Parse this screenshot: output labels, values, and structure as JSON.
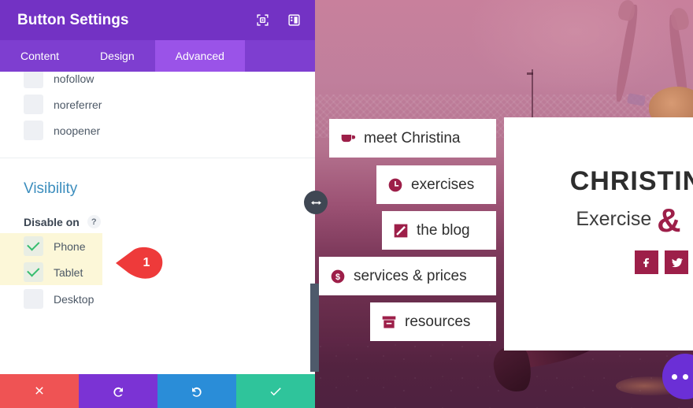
{
  "panel": {
    "title": "Button Settings",
    "header_icons": [
      {
        "name": "focus-icon"
      },
      {
        "name": "panel-layout-icon"
      }
    ],
    "tabs": [
      {
        "label": "Content",
        "active": false
      },
      {
        "label": "Design",
        "active": false
      },
      {
        "label": "Advanced",
        "active": true
      }
    ],
    "rel_options": [
      {
        "label": "nofollow",
        "checked": false
      },
      {
        "label": "noreferrer",
        "checked": false
      },
      {
        "label": "noopener",
        "checked": false
      }
    ],
    "visibility": {
      "section_title": "Visibility",
      "field_label": "Disable on",
      "help_glyph": "?",
      "options": [
        {
          "label": "Phone",
          "checked": true,
          "highlighted": true
        },
        {
          "label": "Tablet",
          "checked": true,
          "highlighted": true
        },
        {
          "label": "Desktop",
          "checked": false,
          "highlighted": false
        }
      ]
    },
    "footer_actions": [
      {
        "name": "close-button",
        "icon": "x-icon",
        "color": "#ef5354"
      },
      {
        "name": "undo-button",
        "icon": "undo-icon",
        "color": "#7b33d4"
      },
      {
        "name": "redo-button",
        "icon": "redo-icon",
        "color": "#2a8dd8"
      },
      {
        "name": "save-button",
        "icon": "check-icon",
        "color": "#2fc49b"
      }
    ],
    "accent_color": "#7332c4",
    "tab_active_color": "#9a53e8",
    "section_title_color": "#3b8dbd",
    "checkbox_check_color": "#36bd6f",
    "highlight_color": "#fcf7d8"
  },
  "marker": {
    "label": "1",
    "color": "#ee3a3a"
  },
  "site": {
    "brand_title": "CHRISTIN",
    "brand_subtitle": "Exercise ",
    "brand_amp": "&",
    "brand_color": "#9d1f49",
    "social": [
      {
        "name": "facebook-icon"
      },
      {
        "name": "twitter-icon"
      }
    ],
    "nav": [
      {
        "label": "meet Christina",
        "icon": "coffee-cup-icon"
      },
      {
        "label": "exercises",
        "icon": "clock-icon"
      },
      {
        "label": "the blog",
        "icon": "pencil-icon"
      },
      {
        "label": "services & prices",
        "icon": "dollar-circle-icon"
      },
      {
        "label": "resources",
        "icon": "archive-box-icon"
      }
    ]
  },
  "overlay": {
    "resize_handle_icon": "arrows-horizontal-icon",
    "ellipsis_icon": "ellipsis-icon"
  }
}
